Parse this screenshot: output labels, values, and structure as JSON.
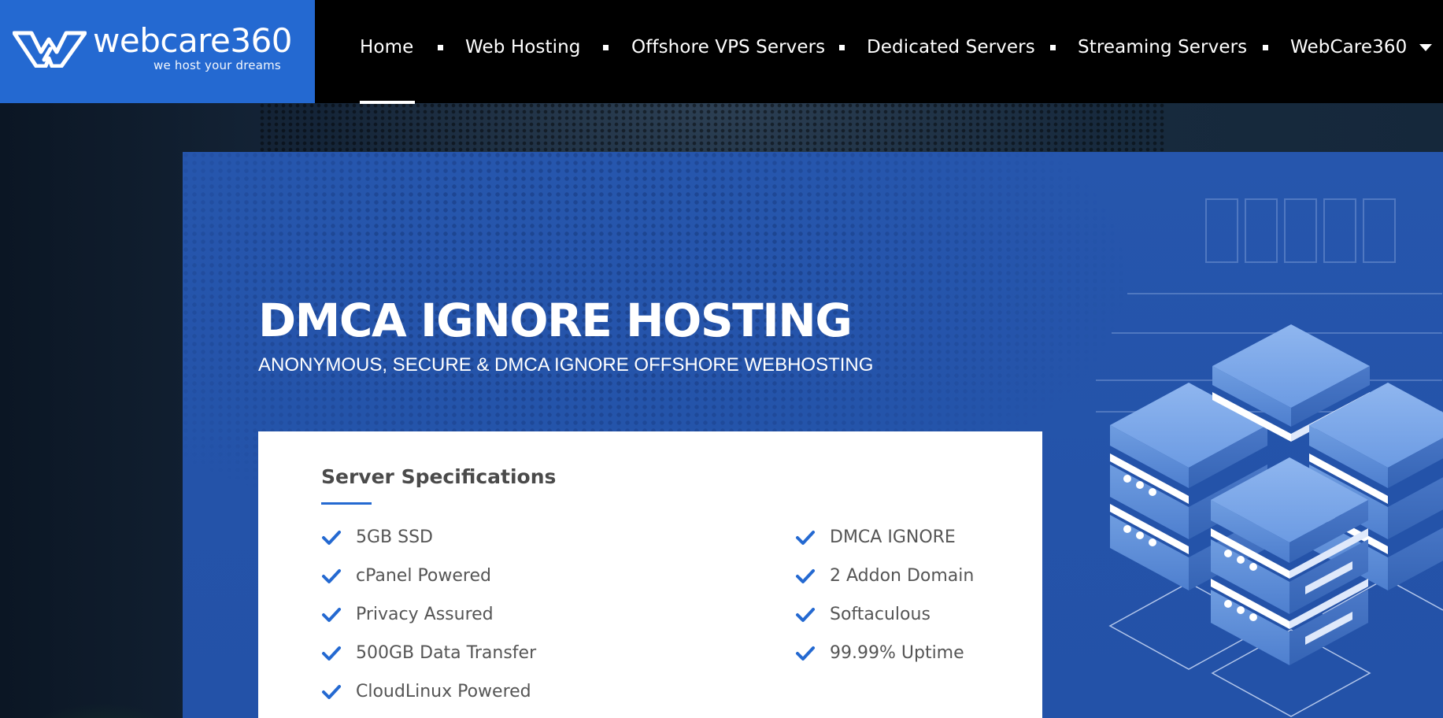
{
  "brand": {
    "name": "webcare360",
    "tagline": "we host your dreams",
    "colors": {
      "primary": "#2469d1",
      "panel": "#2453a9",
      "navbar": "#000000"
    }
  },
  "nav": {
    "items": [
      {
        "label": "Home",
        "active": true
      },
      {
        "label": "Web Hosting"
      },
      {
        "label": "Offshore VPS Servers"
      },
      {
        "label": "Dedicated Servers"
      },
      {
        "label": "Streaming Servers"
      },
      {
        "label": "WebCare360",
        "has_dropdown": true
      }
    ],
    "dropdown_icon": "caret-down-icon"
  },
  "hero": {
    "title": "DMCA IGNORE HOSTING",
    "subtitle": "ANONYMOUS, SECURE & DMCA IGNORE OFFSHORE WEBHOSTING"
  },
  "specs": {
    "title": "Server Specifications",
    "check_icon": "checkmark-icon",
    "left": [
      "5GB SSD",
      "cPanel Powered",
      "Privacy Assured",
      "500GB Data Transfer",
      "CloudLinux Powered"
    ],
    "right": [
      "DMCA IGNORE",
      "2 Addon Domain",
      "Softaculous",
      "99.99% Uptime"
    ]
  }
}
